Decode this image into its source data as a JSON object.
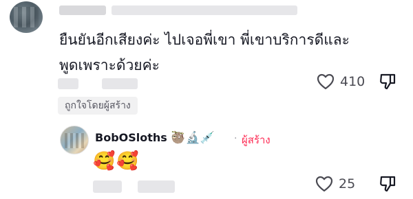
{
  "comment": {
    "text": "ยืนยันอีกเสียงค่ะ ไปเจอพี่เขา พี่เขาบริการดีและ\nพูดเพราะด้วยค่ะ",
    "like_count": "410",
    "liked_by_creator_label": "ถูกใจโดยผู้สร้าง"
  },
  "reply": {
    "username": "BobOSloths",
    "username_emojis": "🦥🔬💉",
    "creator_label": "ผู้สร้าง",
    "separator": "·",
    "text": "🥰🥰",
    "like_count": "25"
  },
  "colors": {
    "creator_accent": "#fe2c55",
    "text_primary": "#161823",
    "text_secondary": "#4a4a52",
    "chip_background": "#f1f1f2"
  }
}
